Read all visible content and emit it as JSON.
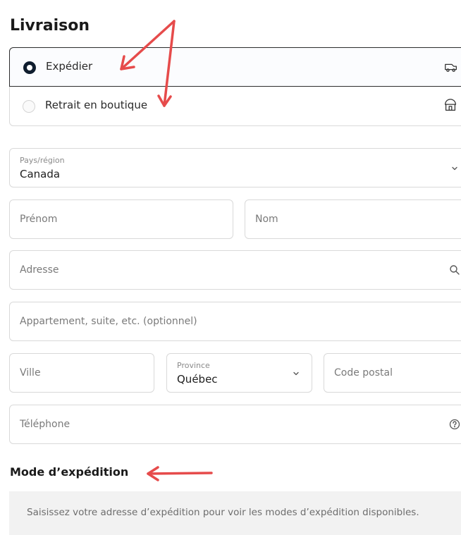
{
  "sections": {
    "delivery_title": "Livraison",
    "shipping_method_title": "Mode d’expédition"
  },
  "delivery_options": [
    {
      "label": "Expédier",
      "selected": true,
      "icon": "truck-icon"
    },
    {
      "label": "Retrait en boutique",
      "selected": false,
      "icon": "store-icon"
    }
  ],
  "form": {
    "country": {
      "label": "Pays/région",
      "value": "Canada"
    },
    "first_name": {
      "placeholder": "Prénom"
    },
    "last_name": {
      "placeholder": "Nom"
    },
    "address": {
      "placeholder": "Adresse"
    },
    "apartment": {
      "placeholder": "Appartement, suite, etc. (optionnel)"
    },
    "city": {
      "placeholder": "Ville"
    },
    "province": {
      "label": "Province",
      "value": "Québec"
    },
    "postal_code": {
      "placeholder": "Code postal"
    },
    "phone": {
      "placeholder": "Téléphone"
    }
  },
  "shipping_notice": "Saisissez votre adresse d’expédition pour voir les modes d’expédition disponibles.",
  "colors": {
    "selected_radio": "#0f1d2e",
    "annotation_arrow": "#e64b4b",
    "notice_background": "#f2f2f2"
  }
}
